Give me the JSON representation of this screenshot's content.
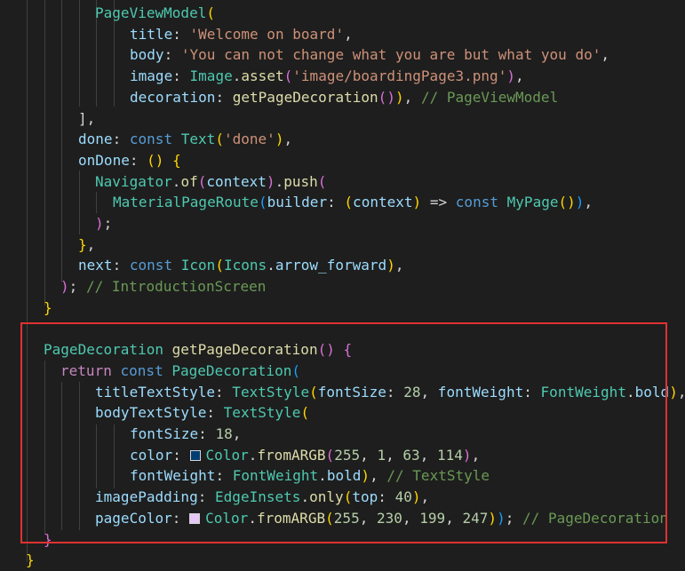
{
  "colors": {
    "background": "#1e1e1e",
    "highlight_box": "#e03131",
    "swatch_dark_blue": "#013f72",
    "swatch_pink": "#e6c7f7"
  },
  "lines": [
    {
      "indent": 107,
      "tokens": [
        [
          "cls",
          "PageViewModel"
        ],
        [
          "p1",
          "("
        ]
      ]
    },
    {
      "indent": 146,
      "tokens": [
        [
          "prop",
          "title"
        ],
        [
          "pun",
          ": "
        ],
        [
          "str",
          "'Welcome on board'"
        ],
        [
          "pun",
          ","
        ]
      ]
    },
    {
      "indent": 146,
      "tokens": [
        [
          "prop",
          "body"
        ],
        [
          "pun",
          ": "
        ],
        [
          "str",
          "'You can not change what you are but what you do'"
        ],
        [
          "pun",
          ","
        ]
      ]
    },
    {
      "indent": 146,
      "tokens": [
        [
          "prop",
          "image"
        ],
        [
          "pun",
          ": "
        ],
        [
          "cls",
          "Image"
        ],
        [
          "pun",
          "."
        ],
        [
          "fn",
          "asset"
        ],
        [
          "p2",
          "("
        ],
        [
          "str",
          "'image/boardingPage3.png'"
        ],
        [
          "p2",
          ")"
        ],
        [
          "pun",
          ","
        ]
      ]
    },
    {
      "indent": 146,
      "tokens": [
        [
          "prop",
          "decoration"
        ],
        [
          "pun",
          ": "
        ],
        [
          "fn",
          "getPageDecoration"
        ],
        [
          "p2",
          "("
        ],
        [
          "p2",
          ")"
        ],
        [
          "p1",
          ")"
        ],
        [
          "pun",
          ", "
        ],
        [
          "cmt",
          "// PageViewModel"
        ]
      ]
    },
    {
      "indent": 88,
      "tokens": [
        [
          "pun",
          "],"
        ]
      ]
    },
    {
      "indent": 88,
      "tokens": [
        [
          "prop",
          "done"
        ],
        [
          "pun",
          ": "
        ],
        [
          "kw",
          "const "
        ],
        [
          "cls",
          "Text"
        ],
        [
          "p1",
          "("
        ],
        [
          "str",
          "'done'"
        ],
        [
          "p1",
          ")"
        ],
        [
          "pun",
          ","
        ]
      ]
    },
    {
      "indent": 88,
      "tokens": [
        [
          "prop",
          "onDone"
        ],
        [
          "pun",
          ": "
        ],
        [
          "p1",
          "()"
        ],
        [
          "pun",
          " "
        ],
        [
          "p1",
          "{"
        ]
      ]
    },
    {
      "indent": 107,
      "tokens": [
        [
          "cls",
          "Navigator"
        ],
        [
          "pun",
          "."
        ],
        [
          "fn",
          "of"
        ],
        [
          "p2",
          "("
        ],
        [
          "prop",
          "context"
        ],
        [
          "p2",
          ")"
        ],
        [
          "pun",
          "."
        ],
        [
          "fn",
          "push"
        ],
        [
          "p2",
          "("
        ]
      ]
    },
    {
      "indent": 127,
      "tokens": [
        [
          "cls",
          "MaterialPageRoute"
        ],
        [
          "p3",
          "("
        ],
        [
          "prop",
          "builder"
        ],
        [
          "pun",
          ": "
        ],
        [
          "p1",
          "("
        ],
        [
          "prop",
          "context"
        ],
        [
          "p1",
          ")"
        ],
        [
          "pun",
          " => "
        ],
        [
          "kw",
          "const "
        ],
        [
          "cls",
          "MyPage"
        ],
        [
          "p1",
          "()"
        ],
        [
          "p3",
          ")"
        ],
        [
          "pun",
          ","
        ]
      ]
    },
    {
      "indent": 107,
      "tokens": [
        [
          "p2",
          ")"
        ],
        [
          "pun",
          ";"
        ]
      ]
    },
    {
      "indent": 88,
      "tokens": [
        [
          "p1",
          "}"
        ],
        [
          "pun",
          ","
        ]
      ]
    },
    {
      "indent": 88,
      "tokens": [
        [
          "prop",
          "next"
        ],
        [
          "pun",
          ": "
        ],
        [
          "kw",
          "const "
        ],
        [
          "cls",
          "Icon"
        ],
        [
          "p1",
          "("
        ],
        [
          "cls",
          "Icons"
        ],
        [
          "pun",
          "."
        ],
        [
          "prop",
          "arrow_forward"
        ],
        [
          "p1",
          ")"
        ],
        [
          "pun",
          ","
        ]
      ]
    },
    {
      "indent": 68,
      "tokens": [
        [
          "p2",
          ")"
        ],
        [
          "pun",
          "; "
        ],
        [
          "cmt",
          "// IntroductionScreen"
        ]
      ]
    },
    {
      "indent": 49,
      "tokens": [
        [
          "p1",
          "}"
        ]
      ]
    },
    {
      "indent": 0,
      "tokens": []
    },
    {
      "indent": 49,
      "tokens": [
        [
          "cls",
          "PageDecoration"
        ],
        [
          "pun",
          " "
        ],
        [
          "fn",
          "getPageDecoration"
        ],
        [
          "p2",
          "()"
        ],
        [
          "pun",
          " "
        ],
        [
          "p2",
          "{"
        ]
      ]
    },
    {
      "indent": 68,
      "tokens": [
        [
          "ctl",
          "return "
        ],
        [
          "kw",
          "const "
        ],
        [
          "cls",
          "PageDecoration"
        ],
        [
          "p3",
          "("
        ]
      ]
    },
    {
      "indent": 107,
      "tokens": [
        [
          "prop",
          "titleTextStyle"
        ],
        [
          "pun",
          ": "
        ],
        [
          "cls",
          "TextStyle"
        ],
        [
          "p1",
          "("
        ],
        [
          "prop",
          "fontSize"
        ],
        [
          "pun",
          ": "
        ],
        [
          "num",
          "28"
        ],
        [
          "pun",
          ", "
        ],
        [
          "prop",
          "fontWeight"
        ],
        [
          "pun",
          ": "
        ],
        [
          "cls",
          "FontWeight"
        ],
        [
          "pun",
          "."
        ],
        [
          "prop",
          "bold"
        ],
        [
          "p1",
          ")"
        ],
        [
          "pun",
          ","
        ]
      ]
    },
    {
      "indent": 107,
      "tokens": [
        [
          "prop",
          "bodyTextStyle"
        ],
        [
          "pun",
          ": "
        ],
        [
          "cls",
          "TextStyle"
        ],
        [
          "p1",
          "("
        ]
      ]
    },
    {
      "indent": 146,
      "tokens": [
        [
          "prop",
          "fontSize"
        ],
        [
          "pun",
          ": "
        ],
        [
          "num",
          "18"
        ],
        [
          "pun",
          ","
        ]
      ]
    },
    {
      "indent": 146,
      "tokens": [
        [
          "prop",
          "color"
        ],
        [
          "pun",
          ": "
        ],
        [
          "swatch",
          "#013f72"
        ],
        [
          "cls",
          "Color"
        ],
        [
          "pun",
          "."
        ],
        [
          "fn",
          "fromARGB"
        ],
        [
          "p2",
          "("
        ],
        [
          "num",
          "255"
        ],
        [
          "pun",
          ", "
        ],
        [
          "num",
          "1"
        ],
        [
          "pun",
          ", "
        ],
        [
          "num",
          "63"
        ],
        [
          "pun",
          ", "
        ],
        [
          "num",
          "114"
        ],
        [
          "p2",
          ")"
        ],
        [
          "pun",
          ","
        ]
      ]
    },
    {
      "indent": 146,
      "tokens": [
        [
          "prop",
          "fontWeight"
        ],
        [
          "pun",
          ": "
        ],
        [
          "cls",
          "FontWeight"
        ],
        [
          "pun",
          "."
        ],
        [
          "prop",
          "bold"
        ],
        [
          "p1",
          ")"
        ],
        [
          "pun",
          ", "
        ],
        [
          "cmt",
          "// TextStyle"
        ]
      ]
    },
    {
      "indent": 107,
      "tokens": [
        [
          "prop",
          "imagePadding"
        ],
        [
          "pun",
          ": "
        ],
        [
          "cls",
          "EdgeInsets"
        ],
        [
          "pun",
          "."
        ],
        [
          "fn",
          "only"
        ],
        [
          "p1",
          "("
        ],
        [
          "prop",
          "top"
        ],
        [
          "pun",
          ": "
        ],
        [
          "num",
          "40"
        ],
        [
          "p1",
          ")"
        ],
        [
          "pun",
          ","
        ]
      ]
    },
    {
      "indent": 107,
      "tokens": [
        [
          "prop",
          "pageColor"
        ],
        [
          "pun",
          ": "
        ],
        [
          "swatch",
          "#e6c7f7"
        ],
        [
          "cls",
          "Color"
        ],
        [
          "pun",
          "."
        ],
        [
          "fn",
          "fromARGB"
        ],
        [
          "p1",
          "("
        ],
        [
          "num",
          "255"
        ],
        [
          "pun",
          ", "
        ],
        [
          "num",
          "230"
        ],
        [
          "pun",
          ", "
        ],
        [
          "num",
          "199"
        ],
        [
          "pun",
          ", "
        ],
        [
          "num",
          "247"
        ],
        [
          "p1",
          ")"
        ],
        [
          "p3",
          ")"
        ],
        [
          "pun",
          "; "
        ],
        [
          "cmt",
          "// PageDecoration"
        ]
      ]
    },
    {
      "indent": 49,
      "tokens": [
        [
          "p2",
          "}"
        ]
      ]
    },
    {
      "indent": 29,
      "tokens": [
        [
          "p1",
          "}"
        ]
      ]
    }
  ]
}
